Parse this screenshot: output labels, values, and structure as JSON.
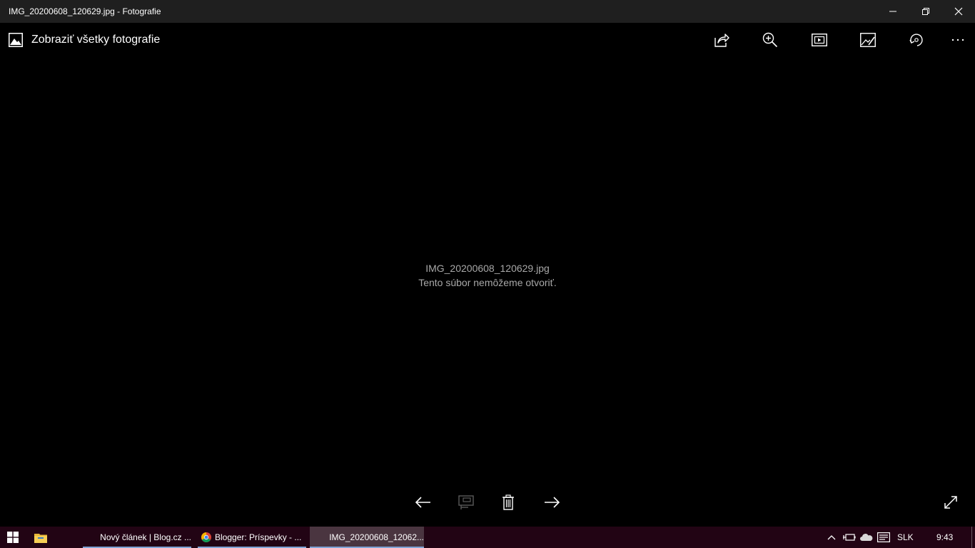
{
  "window": {
    "title": "IMG_20200608_120629.jpg - Fotografie",
    "controls": [
      "minimize-icon",
      "restore-icon",
      "close-icon"
    ]
  },
  "appbar": {
    "view_all_label": "Zobraziť všetky fotografie",
    "view_all_icon": "picture-icon",
    "toolbar_icons": [
      "share-icon",
      "zoom-icon",
      "slideshow-icon",
      "edit-create-icon",
      "rotate-icon",
      "more-icon"
    ]
  },
  "message": {
    "filename": "IMG_20200608_120629.jpg",
    "error": "Tento súbor nemôžeme otvoriť."
  },
  "bottom_bar": {
    "icons": [
      "previous-arrow-icon",
      "add-to-album-icon",
      "delete-icon",
      "next-arrow-icon",
      "fullscreen-icon"
    ],
    "add_to_album_disabled": true
  },
  "taskbar": {
    "background": "#220414",
    "accent": "#7fa3d6",
    "tasks": [
      {
        "label": "Nový článek | Blog.cz ...",
        "icon": "edge-icon",
        "active": false
      },
      {
        "label": "Blogger: Príspevky - ...",
        "icon": "chrome-icon",
        "active": false
      },
      {
        "label": "IMG_20200608_12062...",
        "icon": "photos-icon",
        "active": true
      }
    ],
    "language": "SLK",
    "time": "9:43"
  }
}
